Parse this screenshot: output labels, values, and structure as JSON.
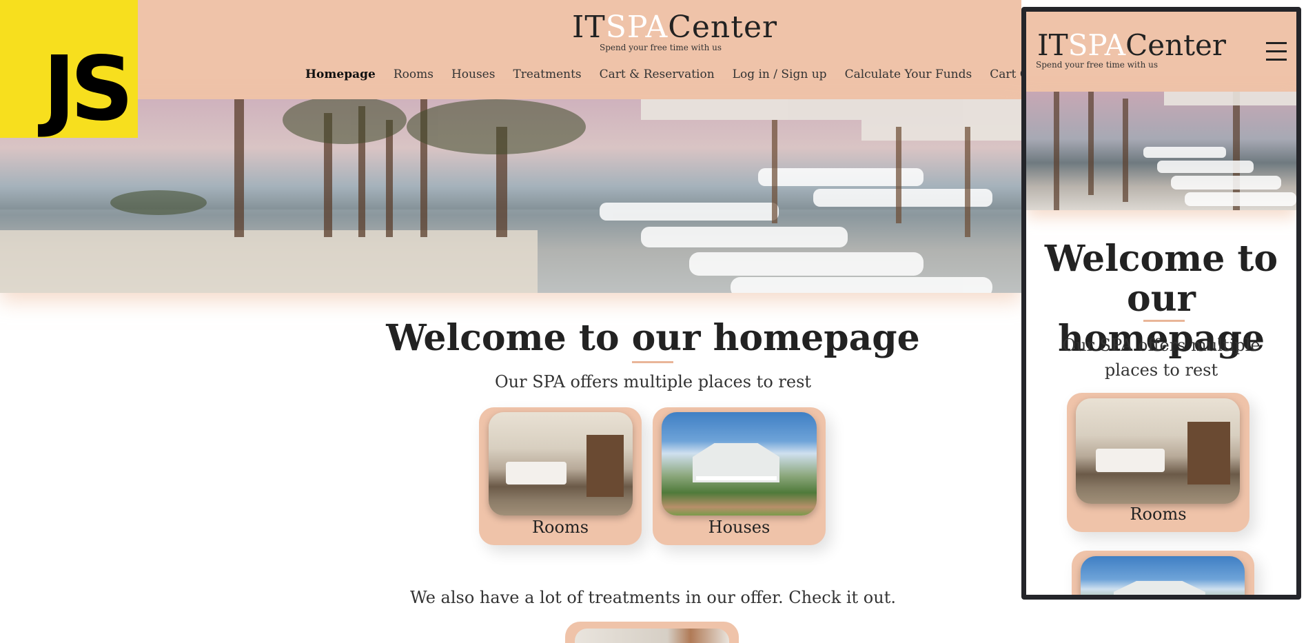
{
  "badge": {
    "text": "JS"
  },
  "brand": {
    "part1": "IT",
    "part2": "SPA",
    "part3": "Center",
    "tagline": "Spend your free time with us"
  },
  "nav": {
    "items": [
      {
        "label": "Homepage"
      },
      {
        "label": "Rooms"
      },
      {
        "label": "Houses"
      },
      {
        "label": "Treatments"
      },
      {
        "label": "Cart & Reservation"
      },
      {
        "label": "Log in / Sign up"
      },
      {
        "label": "Calculate Your Funds"
      },
      {
        "label": "Cart Quantity"
      }
    ]
  },
  "main": {
    "title": "Welcome to our homepage",
    "subtitle": "Our SPA offers multiple places to rest",
    "cards": [
      {
        "label": "Rooms"
      },
      {
        "label": "Houses"
      }
    ],
    "treatments_text": "We also have a lot of treatments in our offer. Check it out."
  },
  "mobile": {
    "title": "Welcome to our homepage",
    "subtitle": "Our SPA offers multiple places to rest",
    "cards": [
      {
        "label": "Rooms"
      }
    ]
  },
  "colors": {
    "accent": "#efc3a9",
    "badge": "#f7df1e",
    "frame": "#24252a"
  },
  "icons": {
    "menu": "hamburger-menu-icon"
  }
}
